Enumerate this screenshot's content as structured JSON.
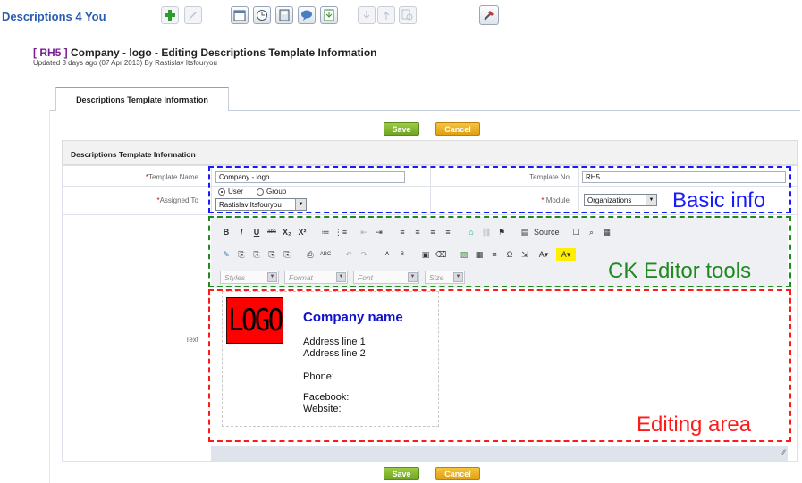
{
  "app": {
    "brand": "Descriptions 4 You"
  },
  "toolbar": {
    "icons": [
      "add-icon",
      "edit-icon",
      "calendar-icon",
      "clock-icon",
      "calculator-icon",
      "chat-icon",
      "import-icon",
      "export-up-icon",
      "export-down-icon",
      "find-duplicates-icon",
      "settings-tool-icon"
    ]
  },
  "record": {
    "id": "[ RH5 ]",
    "title": "Company - logo - Editing Descriptions Template Information",
    "updated": "Updated 3 days ago (07 Apr 2013) By Rastislav Itsfouryou"
  },
  "tab": {
    "label": "Descriptions Template Information"
  },
  "buttons": {
    "save": "Save",
    "cancel": "Cancel"
  },
  "section": {
    "title": "Descriptions Template Information"
  },
  "form": {
    "template_name_label": "Template Name",
    "template_name_value": "Company - logo",
    "template_no_label": "Template No",
    "template_no_value": "RH5",
    "assigned_to_label": "Assigned To",
    "assign_user": "User",
    "assign_group": "Group",
    "assigned_user_value": "Rastislav Itsfouryou",
    "module_label": "Module",
    "module_value": "Organizations",
    "text_label": "Text",
    "required_mark": "*"
  },
  "ck": {
    "row1": [
      "B",
      "I",
      "U",
      "abc",
      "X₂",
      "X²",
      "≔",
      "⋮≡",
      "⇤",
      "⇥",
      "≡",
      "≡",
      "≡",
      "≡",
      "⌂",
      "⛓",
      "⚑",
      "▤",
      "Source",
      "☐",
      "⌕",
      "▦"
    ],
    "row2": [
      "✎",
      "⎘",
      "⎘",
      "⎘",
      "⎘",
      "⎙",
      "ABC",
      "↶",
      "↷",
      "ᴬ",
      "ᴮ",
      "▣",
      "⌫",
      "▧",
      "▦",
      "≡",
      "Ω",
      "⇲",
      "A▾",
      "A▾"
    ],
    "styles": "Styles",
    "format": "Format",
    "font": "Font",
    "size": "Size"
  },
  "template_content": {
    "logo": "LOGO",
    "company_name": "Company name",
    "address1": "Address line 1",
    "address2": "Address line 2",
    "phone": "Phone:",
    "facebook": "Facebook:",
    "website": "Website:"
  },
  "annotations": {
    "basic_info": {
      "label": "Basic info",
      "color": "#1a1aff"
    },
    "ck_tools": {
      "label": "CK Editor tools",
      "color": "#1f8a1f"
    },
    "editing_area": {
      "label": "Editing area",
      "color": "#ff1a1a"
    }
  }
}
